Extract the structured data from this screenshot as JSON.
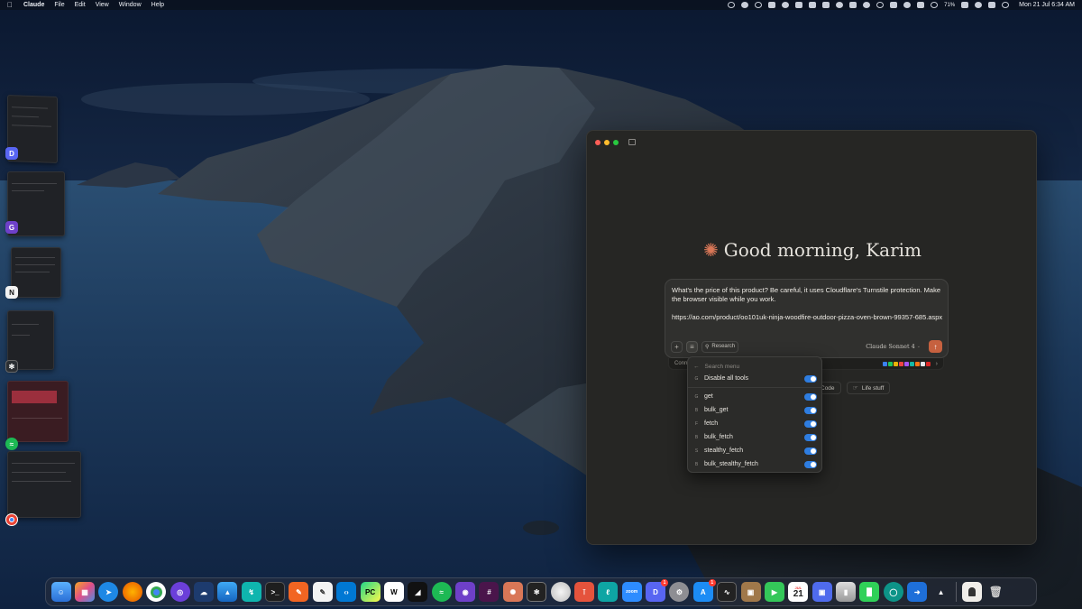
{
  "menubar": {
    "app_name": "Claude",
    "menus": [
      "File",
      "Edit",
      "View",
      "Window",
      "Help"
    ],
    "battery": "71%",
    "clock": "Mon 21 Jul  6:34 AM"
  },
  "stage_manager": {
    "apps": [
      "discord",
      "github",
      "notion",
      "chatgpt",
      "spotify",
      "chrome"
    ]
  },
  "window": {
    "greeting": "Good morning, Karim",
    "composer": {
      "prompt_line1": "What's the price of this product? Be careful, it uses Cloudflare's Turnstile protection. Make the browser visible while you work.",
      "prompt_line2": "https://ao.com/product/oo101uk-ninja-woodfire-outdoor-pizza-oven-brown-99357-685.aspx",
      "add_label": "+",
      "tools_label": "≡",
      "research_label": "Research",
      "model_label": "Claude Sonnet 4",
      "send_label": "↑"
    },
    "connector_bar": {
      "label": "Conn"
    },
    "chips": [
      {
        "icon": "code-icon",
        "label": "Code"
      },
      {
        "icon": "hand-icon",
        "label": "Life stuff"
      }
    ]
  },
  "tools_menu": {
    "search_placeholder": "Search menu",
    "disable_all": "Disable all tools",
    "tools": [
      {
        "letter": "G",
        "name": "get",
        "enabled": true
      },
      {
        "letter": "B",
        "name": "bulk_get",
        "enabled": true
      },
      {
        "letter": "F",
        "name": "fetch",
        "enabled": true
      },
      {
        "letter": "B",
        "name": "bulk_fetch",
        "enabled": true
      },
      {
        "letter": "S",
        "name": "stealthy_fetch",
        "enabled": true
      },
      {
        "letter": "B",
        "name": "bulk_stealthy_fetch",
        "enabled": true
      }
    ]
  },
  "dock": {
    "calendar_month": "JUL",
    "calendar_day": "21",
    "badges": {
      "discord": "1",
      "app_store": "1"
    },
    "zoom_label": "zoom"
  },
  "colors": {
    "accent": "#d97757",
    "send_button": "#c6613f",
    "toggle_on": "#2e7de0",
    "window_bg": "#262624"
  }
}
